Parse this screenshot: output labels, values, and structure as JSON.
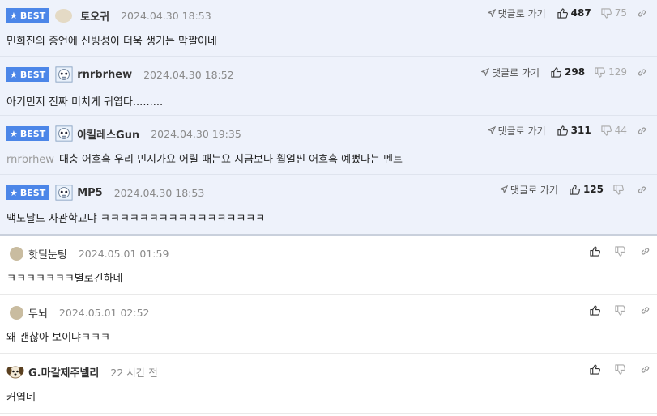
{
  "best_label": "BEST",
  "reply_label": "댓글로 가기",
  "best_comments": [
    {
      "nick": "토오귀",
      "avatar": "blob",
      "time": "2024.04.30 18:53",
      "text": "민희진의 증언에 신빙성이 더욱 생기는 막짤이네",
      "quoted": "",
      "up": "487",
      "down": "75"
    },
    {
      "nick": "rnrbrhew",
      "avatar": "robot",
      "time": "2024.04.30 18:52",
      "text": "아기민지 진짜 미치게 귀엽다.........",
      "quoted": "",
      "up": "298",
      "down": "129"
    },
    {
      "nick": "아킬레스Gun",
      "avatar": "robot",
      "time": "2024.04.30 19:35",
      "text": "대충 어흐흑 우리 민지가요 어릴 때는요 지금보다 훨얼씬 어흐흑 예뻤다는 멘트",
      "quoted": "rnrbrhew",
      "up": "311",
      "down": "44"
    },
    {
      "nick": "MP5",
      "avatar": "robot",
      "time": "2024.04.30 18:53",
      "text": "맥도날드 사관학교냐 ㅋㅋㅋㅋㅋㅋㅋㅋㅋㅋㅋㅋㅋㅋㅋㅋㅋ",
      "quoted": "",
      "up": "125",
      "down": ""
    }
  ],
  "comments": [
    {
      "nick": "핫딜눈팅",
      "avatar": "round",
      "time": "2024.05.01 01:59",
      "text": "ㅋㅋㅋㅋㅋㅋㅋ별로긴하네"
    },
    {
      "nick": "두뇌",
      "avatar": "round",
      "time": "2024.05.01 02:52",
      "text": "왜 괜찮아 보이냐ㅋㅋㅋ"
    },
    {
      "nick": "G.마갈제주넬리",
      "avatar": "dog",
      "time": "22 시간 전",
      "text": "커엽네"
    }
  ],
  "colors": {
    "best_bg": "#eef2fb",
    "badge": "#4c86e8"
  },
  "icons": [
    "star-icon",
    "reply-arrow-icon",
    "thumbs-up-icon",
    "thumbs-down-icon",
    "link-icon"
  ]
}
